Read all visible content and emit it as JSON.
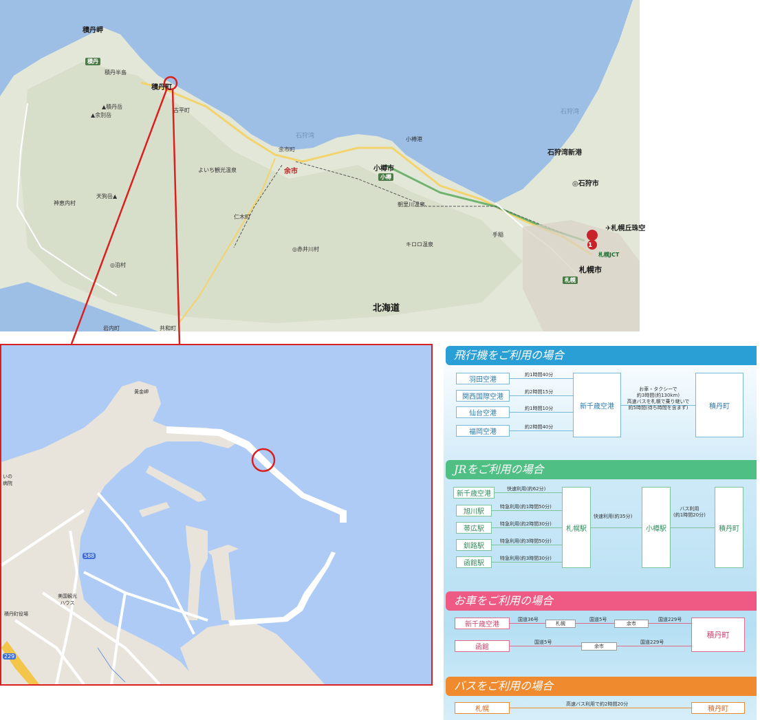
{
  "top_map": {
    "places": {
      "shakotan_misaki": "積丹岬",
      "shakotan_badge": "積丹",
      "shakotan_peninsula": "積丹半島",
      "shakotan_dake": "▲積丹岳",
      "yoichi_dake": "▲余別岳",
      "shakotan_town": "積丹町",
      "furubira": "古平町",
      "yoichi": "余市",
      "yoichi_town": "余市町",
      "otaru": "小樽",
      "otaru_city": "小樽市",
      "otaru_port": "小樽港",
      "ishikari_bay": "石狩湾",
      "ishikari_bay2": "石狩湾",
      "ishikari_shinko": "石狩湾新港",
      "ishikari_city": "◎石狩市",
      "sapporo": "札幌市",
      "sapporo_badge": "札幌",
      "sapporo_jct": "札幌JCT",
      "okadama": "✈札幌丘珠空",
      "hokkaido": "北海道",
      "niki": "仁木町",
      "akaigawa": "◎赤井川村",
      "kamoenai": "神恵内村",
      "iwanai": "岩内町",
      "kyowa": "共和町",
      "tomari": "◎泊村",
      "raiden": "天狗岳▲",
      "teine": "手稲",
      "yoichi_onsen": "よいち観光温泉",
      "asari_onsen": "朝里川温泉",
      "kiroro": "キロロ温泉"
    },
    "pin_label": "1"
  },
  "zoom_map": {
    "places": {
      "misaki": "黄金岬",
      "town_office": "積丹町役場",
      "kanko": "美国観光\nハウス",
      "route": "588",
      "route2": "229",
      "left_label": "いの\n病院"
    }
  },
  "access": {
    "airplane": {
      "title": "飛行機をご利用の場合",
      "origins": [
        "羽田空港",
        "関西国際空港",
        "仙台空港",
        "福岡空港"
      ],
      "times": [
        "約1時間40分",
        "約2時間15分",
        "約1時間10分",
        "約2時間40分"
      ],
      "hub": "新千歳空港",
      "transfer_note": "お車・タクシーで\n約3時間(約130km)\n高速バスを札幌で乗り継いで\n約5時間(待ち時間を含まず)",
      "dest": "積丹町"
    },
    "jr": {
      "title": "JRをご利用の場合",
      "origins": [
        "新千歳空港",
        "旭川駅",
        "帯広駅",
        "釧路駅",
        "函館駅"
      ],
      "times": [
        "快速利用(約62分)",
        "特急利用(約1時間50分)",
        "特急利用(約2時間30分)",
        "特急利用(約3時間50分)",
        "特急利用(約3時間30分)"
      ],
      "hub1": "札幌駅",
      "leg1": "快速利用(約35分)",
      "hub2": "小樽駅",
      "leg2": "バス利用\n(約1時間20分)",
      "dest": "積丹町"
    },
    "car": {
      "title": "お車をご利用の場合",
      "row1": {
        "origin": "新千歳空港",
        "r1": "国道36号",
        "p1": "札幌",
        "r2": "国道5号",
        "p2": "余市",
        "r3": "国道229号"
      },
      "row2": {
        "origin": "函館",
        "r1": "国道5号",
        "p1": "余市",
        "r2": "国道229号"
      },
      "dest": "積丹町"
    },
    "bus": {
      "title": "バスをご利用の場合",
      "origin": "札幌",
      "time": "高速バス利用で約2時間20分",
      "dest": "積丹町"
    }
  },
  "colors": {
    "sea": "#9dbfe6",
    "land": "#e3e7d8",
    "callout": "#d91f1f",
    "airplane_header": "#2a9fd6",
    "jr_header": "#4fbf84",
    "car_header": "#ef5a84",
    "bus_header": "#f08a2e"
  }
}
